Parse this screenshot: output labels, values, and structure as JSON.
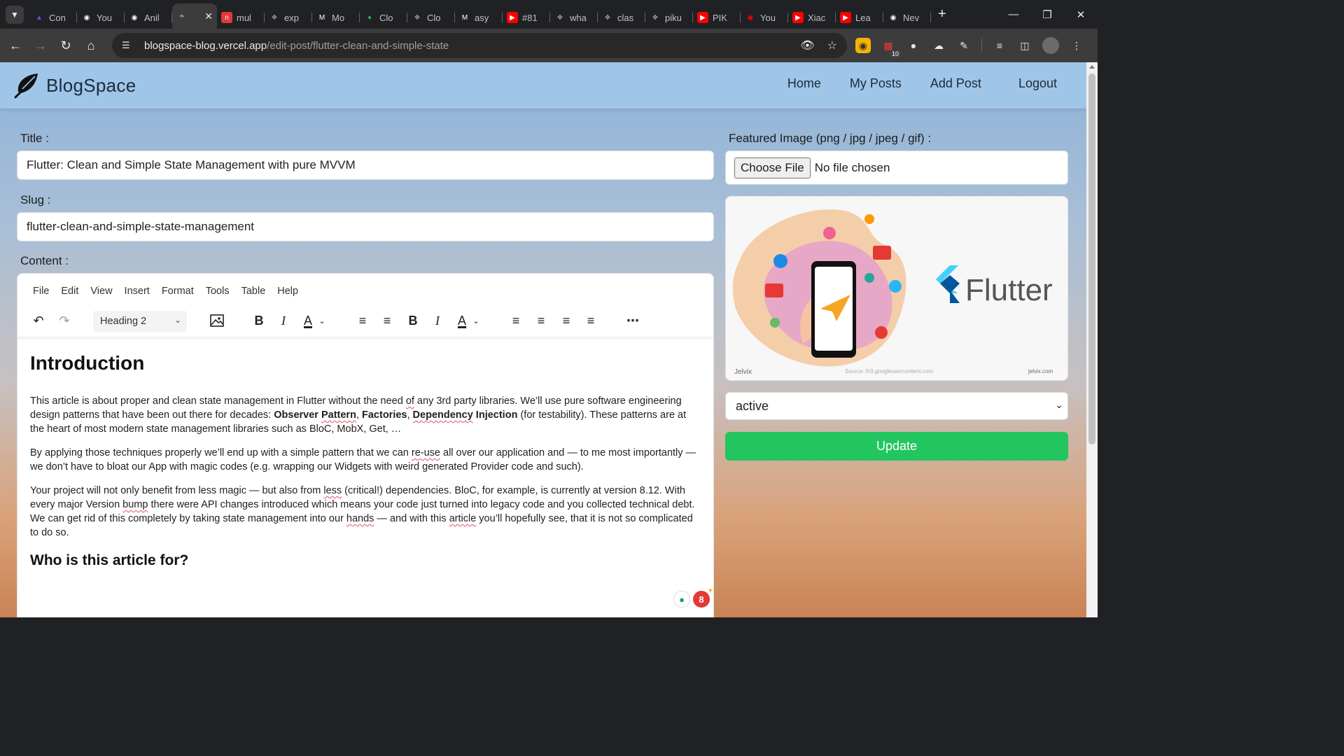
{
  "browser": {
    "tabs": [
      {
        "title": "Con",
        "icon": "app-icon",
        "color": "#6d4aff"
      },
      {
        "title": "You",
        "icon": "github-icon",
        "color": "#ffffff"
      },
      {
        "title": "Anil",
        "icon": "github-icon",
        "color": "#ffffff"
      },
      {
        "title": "",
        "icon": "feather-icon",
        "color": "#9aa0a6",
        "active": true
      },
      {
        "title": "mul",
        "icon": "n-icon",
        "color": "#e53935"
      },
      {
        "title": "exp",
        "icon": "openai-icon",
        "color": "#9aa0a6"
      },
      {
        "title": "Mo",
        "icon": "m-icon",
        "color": "#ffffff"
      },
      {
        "title": "Clo",
        "icon": "leaf-icon",
        "color": "#22c55e"
      },
      {
        "title": "Clo",
        "icon": "openai-icon",
        "color": "#9aa0a6"
      },
      {
        "title": "asy",
        "icon": "medium-icon",
        "color": "#ffffff"
      },
      {
        "title": "#81",
        "icon": "youtube-icon",
        "color": "#ff0000"
      },
      {
        "title": "wha",
        "icon": "openai-icon",
        "color": "#9aa0a6"
      },
      {
        "title": "clas",
        "icon": "openai-icon",
        "color": "#9aa0a6"
      },
      {
        "title": "piku",
        "icon": "openai-icon",
        "color": "#9aa0a6"
      },
      {
        "title": "PIK",
        "icon": "youtube-icon",
        "color": "#ff0000"
      },
      {
        "title": "You",
        "icon": "record-icon",
        "color": "#ff0000"
      },
      {
        "title": "Xiac",
        "icon": "youtube-icon",
        "color": "#ff0000"
      },
      {
        "title": "Lea",
        "icon": "youtube-icon",
        "color": "#ff0000"
      },
      {
        "title": "Nev",
        "icon": "chrome-icon",
        "color": "#ffffff"
      }
    ],
    "url_host": "blogspace-blog.vercel.app",
    "url_path": "/edit-post/flutter-clean-and-simple-state",
    "ext_badge": "10"
  },
  "site": {
    "brand": "BlogSpace",
    "nav": [
      "Home",
      "My Posts",
      "Add Post",
      "Logout"
    ]
  },
  "form": {
    "title_label": "Title :",
    "title_value": "Flutter: Clean and Simple State Management with pure MVVM",
    "slug_label": "Slug :",
    "slug_value": "flutter-clean-and-simple-state-management",
    "content_label": "Content :",
    "image_label": "Featured Image (png / jpg / jpeg / gif) :",
    "file_button": "Choose File",
    "file_status": "No file chosen",
    "status_value": "active",
    "submit_label": "Update"
  },
  "editor": {
    "menu": [
      "File",
      "Edit",
      "View",
      "Insert",
      "Format",
      "Tools",
      "Table",
      "Help"
    ],
    "block_format": "Heading 2",
    "heading": "Introduction",
    "p1_a": "This article is about proper and clean state management in Flutter without the need ",
    "p1_of": "of",
    "p1_b": " any 3rd party libraries. We’ll use pure software engineering design patterns that have been out there for decades: ",
    "p1_obs": "Observer ",
    "p1_pattern": "Pattern",
    "p1_comma": ", ",
    "p1_fact": "Factories",
    "p1_comma2": ", ",
    "p1_dep": "Dependency",
    "p1_inj": " Injection",
    "p1_c": " (for testability). These patterns are at the heart of most modern state management libraries such as BloC, MobX, Get, …",
    "p2_a": "By applying those techniques properly we’ll end up with a simple pattern that we can ",
    "p2_reuse": "re-use",
    "p2_b": " all over our application and — to me most importantly — we don’t have to bloat our App with magic codes (e.g. wrapping our Widgets with weird generated Provider code and such).",
    "p3_a": "Your project will not only benefit from less magic — but also from ",
    "p3_less": "less",
    "p3_b": " (critical!) dependencies. BloC, for example, is currently at version 8.12. With every major Version ",
    "p3_bump": "bump",
    "p3_c": " there were API changes introduced which means your code just turned into legacy code and you collected technical debt. We can get rid of this completely by taking state management into our ",
    "p3_hands": "hands",
    "p3_d": " — and with this ",
    "p3_article": "article",
    "p3_e": " you’ll hopefully see, that it is not so complicated to do so.",
    "subheading": "Who is this article for?"
  },
  "preview": {
    "brand_text": "Flutter",
    "left_caption": "Jelvix",
    "source_caption": "Source: lh3.googleusercontent.com",
    "right_caption": "jelvix.com"
  },
  "floating": {
    "count": "8"
  }
}
